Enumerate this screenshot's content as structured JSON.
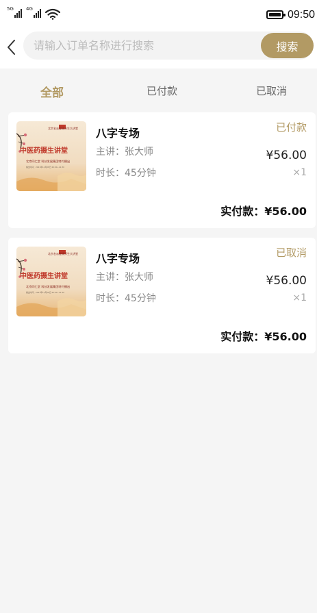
{
  "status_bar": {
    "signal1_label": "5G",
    "signal2_label": "4G",
    "time": "09:50"
  },
  "header": {
    "search_placeholder": "请输入订单名称进行搜索",
    "search_button": "搜索"
  },
  "tabs": [
    {
      "label": "全部",
      "active": true
    },
    {
      "label": "已付款",
      "active": false
    },
    {
      "label": "已取消",
      "active": false
    }
  ],
  "orders": [
    {
      "title": "八字专场",
      "lecturer": "主讲：张大师",
      "duration": "时长：45分钟",
      "status": "已付款",
      "price": "¥56.00",
      "quantity": "×1",
      "paid": "实付款：¥56.00",
      "poster": {
        "top_text": "北京名派健康养生大讲堂",
        "title": "中医药摄生讲堂",
        "subtitle": "北京同仁堂 科技发展集团特约播出",
        "bottom_text": "播出时间：2021年12月28日 20:00~21:30"
      }
    },
    {
      "title": "八字专场",
      "lecturer": "主讲：张大师",
      "duration": "时长：45分钟",
      "status": "已取消",
      "price": "¥56.00",
      "quantity": "×1",
      "paid": "实付款：¥56.00",
      "poster": {
        "top_text": "北京名派健康养生大讲堂",
        "title": "中医药摄生讲堂",
        "subtitle": "北京同仁堂 科技发展集团特约播出",
        "bottom_text": "播出时间：2021年12月28日 20:00~21:30"
      }
    }
  ],
  "colors": {
    "accent": "#b29a64",
    "background": "#f5f5f5",
    "card": "#ffffff",
    "poster_red": "#c0392b"
  },
  "icons": {
    "back": "chevron-left-icon",
    "wifi": "wifi-icon",
    "battery": "battery-icon"
  }
}
